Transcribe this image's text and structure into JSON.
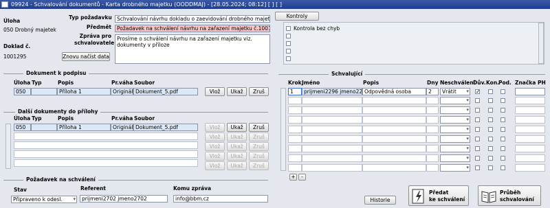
{
  "window": {
    "title": "09924 - Schvalování dokumentů - Karta drobného majetku (OODDMAJ) - [28.05.2024; 08:12]  [ ]  [ ]"
  },
  "header": {
    "uloha_label": "Úloha",
    "uloha_value": "050 Drobný majetek",
    "doklad_label": "Doklad č.",
    "doklad_value": "1001295",
    "reload_button": "Znovu načíst data",
    "typ_label": "Typ požadavku",
    "typ_value": "Schvalování návrhu dokladu o zaevidování drobného majetku do",
    "predmet_label": "Předmět",
    "predmet_value": "Požadavek na schválení návrhu na zařazení majetku č.1001295",
    "zprava_label": "Zpráva pro schvalovatele",
    "zprava_value": "Prosíme o schválení návrhu na zařazení majetku viz. dokumenty v příloze"
  },
  "kontroly": {
    "button": "Kontroly",
    "items": [
      "Kontrola bez chyb",
      "",
      "",
      "",
      ""
    ]
  },
  "doc_to_sign": {
    "title": "Dokument k podpisu",
    "columns": [
      "Úloha",
      "Typ",
      "Popis",
      "Pr.váha",
      "Soubor"
    ],
    "row": {
      "uloha": "050",
      "typ": "",
      "popis": "Příloha 1",
      "prvaha": "Originál",
      "soubor": "Dokument_5.pdf"
    },
    "buttons": {
      "vloz": "Vlož",
      "ukaz": "Ukaž",
      "zrus": "Zruš"
    }
  },
  "attachments": {
    "title": "Další dokumenty do přílohy",
    "columns": [
      "Úloha",
      "Typ",
      "Popis",
      "Pr.váha",
      "Soubor"
    ],
    "rows": [
      {
        "uloha": "050",
        "typ": "",
        "popis": "Příloha 1",
        "prvaha": "Originál",
        "soubor": "Dokument_5.pdf"
      }
    ],
    "buttons": {
      "vloz": "Vlož",
      "ukaz": "Ukaž",
      "zrus": "Zruš"
    }
  },
  "request": {
    "title": "Požadavek na schválení",
    "stav_label": "Stav",
    "stav_value": "Připraveno k odesl.",
    "referent_label": "Referent",
    "referent_value": "prijmeni2702 jmeno2702",
    "komu_label": "Komu zpráva",
    "komu_value": "info@bbm.cz"
  },
  "approvers": {
    "title": "Schvalující",
    "columns": [
      "Krok",
      "Jméno",
      "Popis",
      "Dny",
      "Neschválení",
      "Dův.",
      "Kon.",
      "Pod.",
      "Značka PH"
    ],
    "rows": [
      {
        "krok": "1",
        "jmeno": "prijmeni2296 jmeno2296 6145689",
        "popis": "Odpovědná osoba",
        "dny": "2",
        "neschvaleni": "Vrátit",
        "duv": true,
        "kon": false,
        "pod": false,
        "znacka": ""
      }
    ],
    "add": "+",
    "remove": "-"
  },
  "footer": {
    "historie": "Historie",
    "predat": "Předat\nke schválení",
    "prubeh": "Průběh\nschvalování"
  }
}
